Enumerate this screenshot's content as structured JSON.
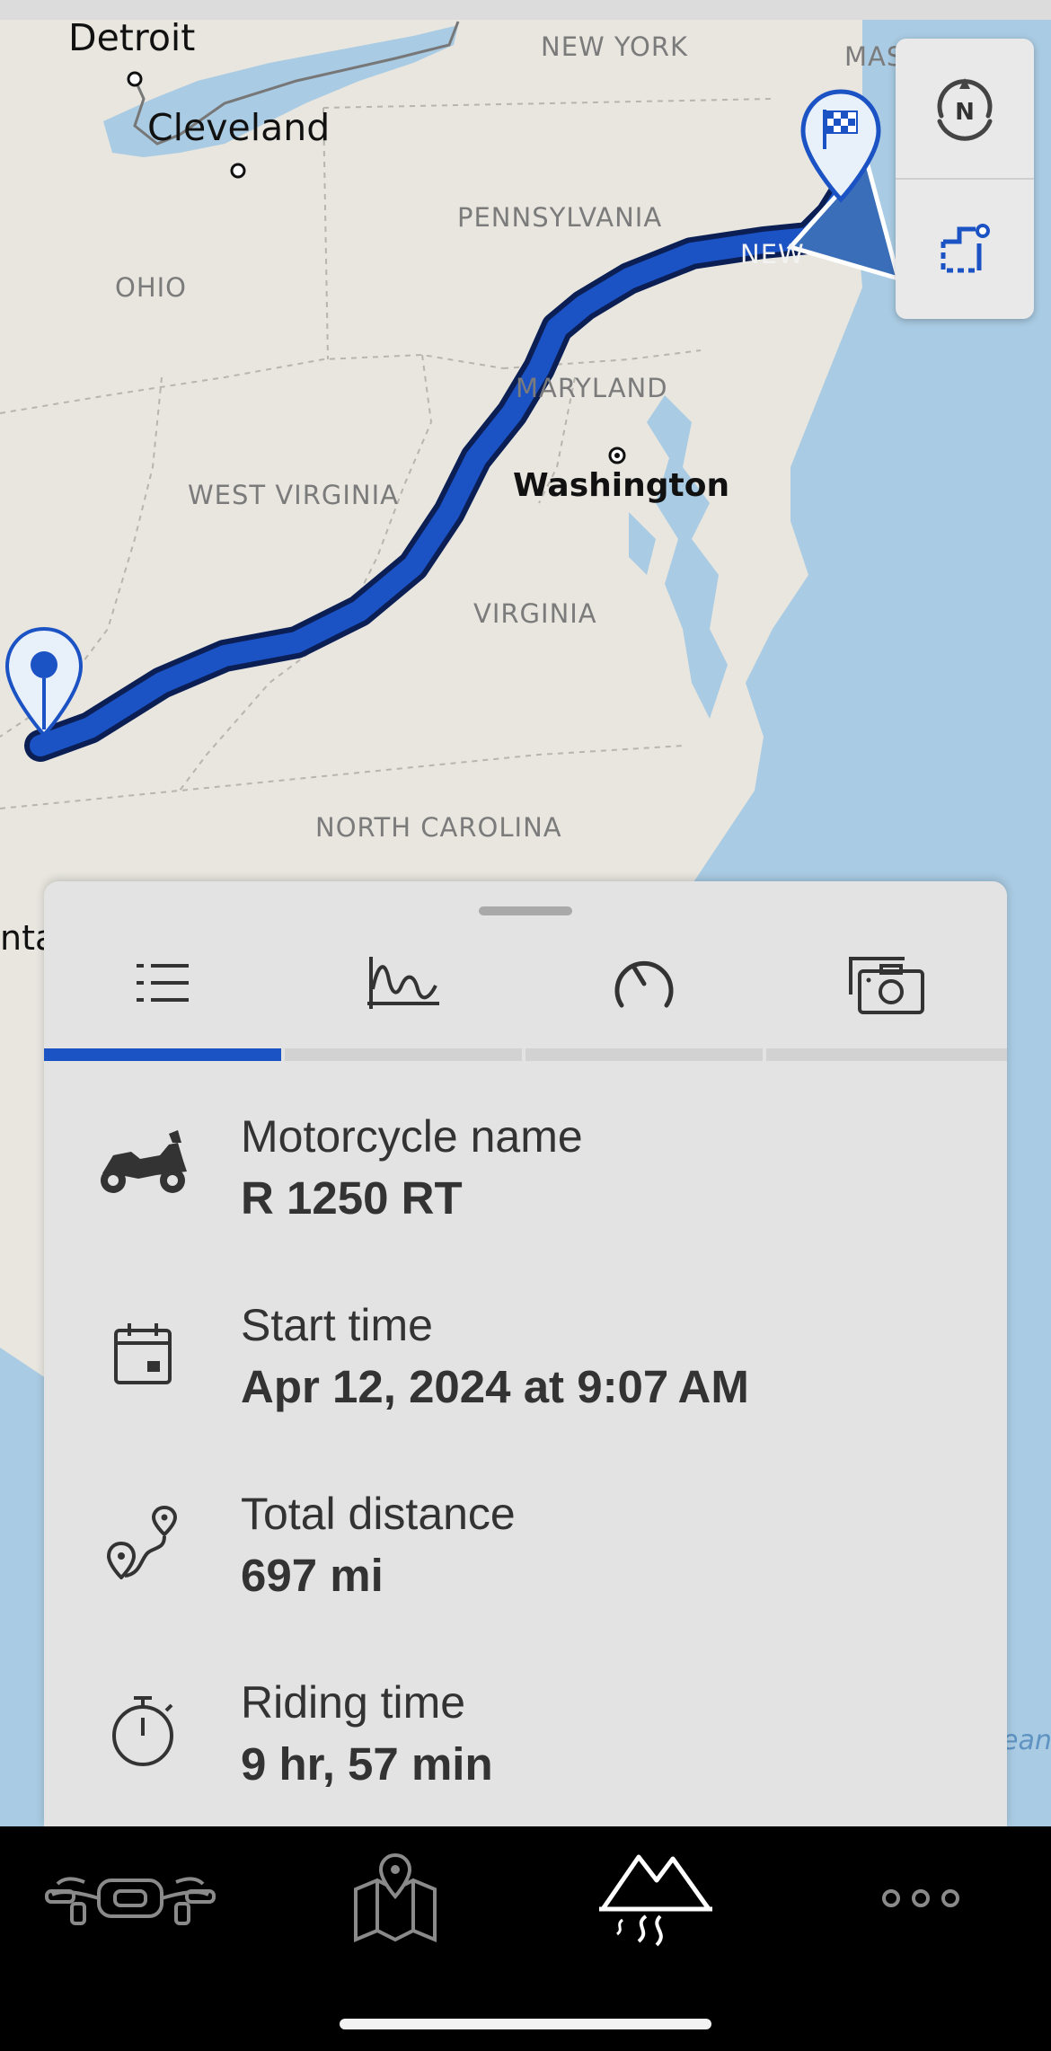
{
  "map": {
    "labels": {
      "detroit": "Detroit",
      "cleveland": "Cleveland",
      "new_york": "NEW YORK",
      "massachusetts": "MAS",
      "pennsylvania": "PENNSYLVANIA",
      "ohio": "OHIO",
      "maryland": "MARYLAND",
      "new_jersey": "NEW",
      "washington": "Washington",
      "west_virginia": "WEST VIRGINIA",
      "virginia": "VIRGINIA",
      "north_carolina": "NORTH CAROLINA",
      "partial_city": "nta",
      "ocean_partial": "ean"
    },
    "route_color": "#1b52c4",
    "start_marker_icon": "location-pin-icon",
    "finish_marker_icon": "checkered-flag-pin-icon",
    "controls": {
      "compass_letter": "N",
      "compass_icon": "compass-north-icon",
      "route_overview_icon": "route-overview-icon"
    }
  },
  "sheet": {
    "tabs": [
      {
        "icon": "list-icon",
        "active": true
      },
      {
        "icon": "elevation-chart-icon",
        "active": false
      },
      {
        "icon": "speedometer-icon",
        "active": false
      },
      {
        "icon": "camera-icon",
        "active": false
      }
    ],
    "details": [
      {
        "icon": "motorcycle-icon",
        "label": "Motorcycle name",
        "value": "R 1250 RT"
      },
      {
        "icon": "calendar-icon",
        "label": "Start time",
        "value": "Apr 12, 2024 at 9:07 AM"
      },
      {
        "icon": "route-distance-icon",
        "label": "Total distance",
        "value": "697 mi"
      },
      {
        "icon": "stopwatch-icon",
        "label": "Riding time",
        "value": "9 hr, 57 min"
      }
    ]
  },
  "bottom_nav": {
    "items": [
      {
        "icon": "motorcycle-handlebar-icon",
        "active": false
      },
      {
        "icon": "map-pin-icon",
        "active": false
      },
      {
        "icon": "mountains-road-icon",
        "active": true
      },
      {
        "icon": "more-dots-icon",
        "active": false
      }
    ]
  },
  "colors": {
    "accent": "#1b52c4",
    "land": "#e8e6df",
    "water": "#a9cbe3"
  }
}
